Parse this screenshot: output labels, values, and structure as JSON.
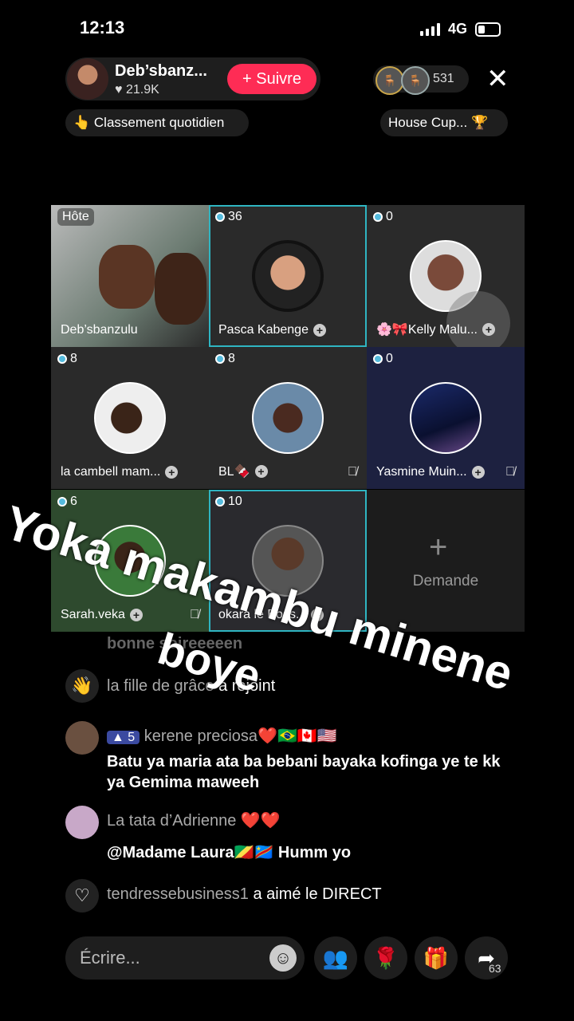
{
  "status": {
    "time": "12:13",
    "network": "4G"
  },
  "host": {
    "name": "Deb’sbanz...",
    "likes": "21.9K",
    "follow_label": "+ Suivre"
  },
  "viewers": {
    "count": "531"
  },
  "ranking": {
    "label": "👆 Classement quotidien"
  },
  "housecup": {
    "label": "House Cup..."
  },
  "grid": [
    {
      "badge": "Hôte",
      "name": "Deb’sbanzulu"
    },
    {
      "count": "36",
      "name": "Pasca Kabenge"
    },
    {
      "count": "0",
      "name": "🌸🎀Kelly Malu..."
    },
    {
      "count": "8",
      "name": "la cambell  mam..."
    },
    {
      "count": "8",
      "name": "BL🍫"
    },
    {
      "count": "0",
      "name": "Yasmine Muin..."
    },
    {
      "count": "6",
      "name": "Sarah.veka"
    },
    {
      "count": "10",
      "name": "okara le Boss..."
    },
    {
      "request": "Demande"
    }
  ],
  "caption": {
    "line1": "Yoka makambu minene",
    "line2": "boye"
  },
  "comments": [
    {
      "partial": "bonne soireeeeen"
    },
    {
      "user": "la fille de grâce",
      "action": "a rejoint"
    },
    {
      "level": "5",
      "user": "kerene preciosa❤️🇧🇷🇨🇦🇺🇸",
      "text": "Batu ya maria ata ba bebani bayaka kofinga ye te kk ya Gemima maweeh"
    },
    {
      "user": "La tata d’Adrienne ❤️❤️",
      "text": "@Madame Laura🇨🇬🇨🇩 Humm yo"
    },
    {
      "user": "tendressebusiness1",
      "action": "a aimé le DIRECT"
    }
  ],
  "bottom": {
    "placeholder": "Écrire...",
    "share_count": "63"
  }
}
